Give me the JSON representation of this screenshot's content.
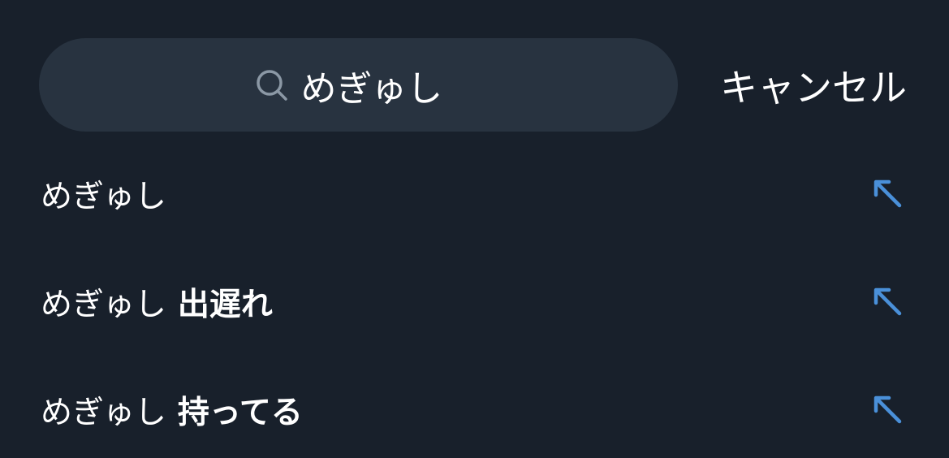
{
  "search": {
    "value": "めぎゅし",
    "icon": "search-icon"
  },
  "header": {
    "cancel_label": "キャンセル"
  },
  "suggestions": [
    {
      "base": "めぎゅし",
      "bold": "",
      "icon": "arrow-up-left-icon"
    },
    {
      "base": "めぎゅし",
      "bold": "出遅れ",
      "icon": "arrow-up-left-icon"
    },
    {
      "base": "めぎゅし",
      "bold": "持ってる",
      "icon": "arrow-up-left-icon"
    }
  ],
  "colors": {
    "background": "#18202b",
    "search_bg": "#283340",
    "accent": "#4a90d9",
    "text": "#ffffff"
  }
}
